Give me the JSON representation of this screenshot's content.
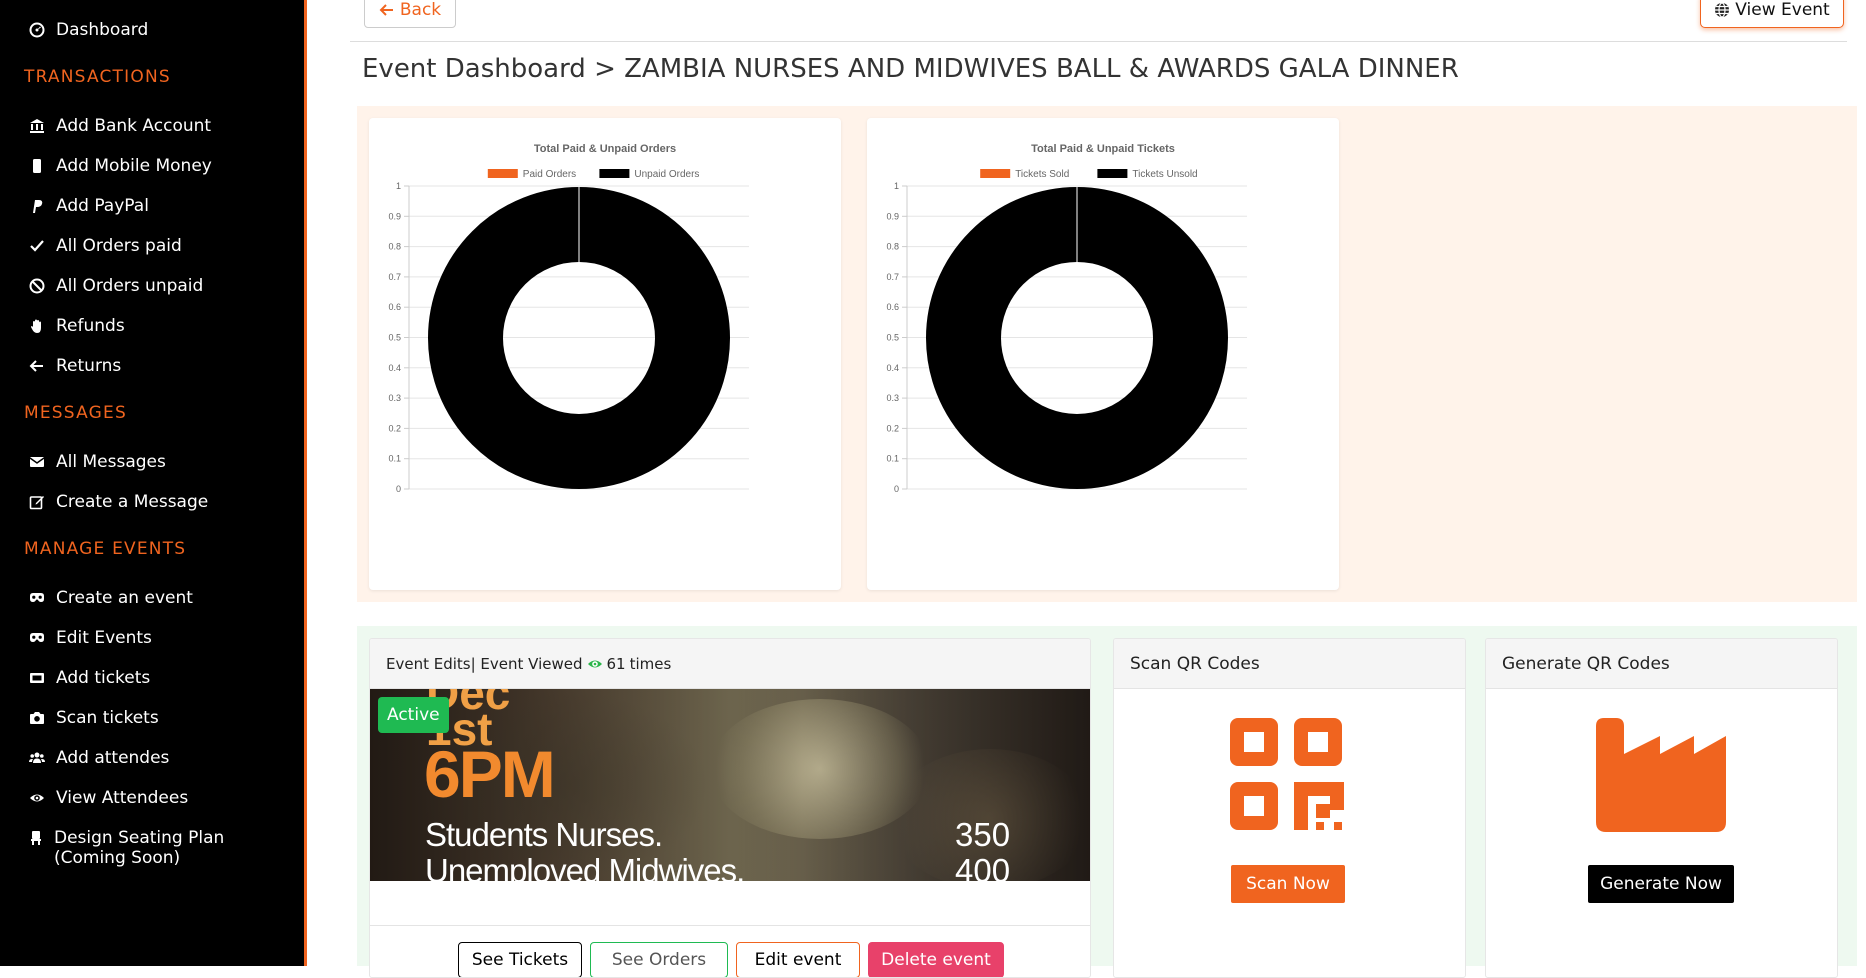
{
  "sidebar": {
    "dashboard": "Dashboard",
    "sections": {
      "transactions": "TRANSACTIONS",
      "messages": "MESSAGES",
      "manage_events": "MANAGE EVENTS"
    },
    "transactions": [
      {
        "label": "Add Bank Account",
        "icon": "bank-icon"
      },
      {
        "label": "Add Mobile Money",
        "icon": "mobile-icon"
      },
      {
        "label": "Add PayPal",
        "icon": "paypal-icon"
      },
      {
        "label": "All Orders paid",
        "icon": "check-icon"
      },
      {
        "label": "All Orders unpaid",
        "icon": "ban-icon"
      },
      {
        "label": "Refunds",
        "icon": "hand-icon"
      },
      {
        "label": "Returns",
        "icon": "arrow-left-icon"
      }
    ],
    "messages": [
      {
        "label": "All Messages",
        "icon": "envelope-icon"
      },
      {
        "label": "Create a Message",
        "icon": "edit-icon"
      }
    ],
    "manage_events": [
      {
        "label": "Create an event",
        "icon": "mask-icon"
      },
      {
        "label": "Edit Events",
        "icon": "mask-icon"
      },
      {
        "label": "Add tickets",
        "icon": "ticket-icon"
      },
      {
        "label": "Scan tickets",
        "icon": "camera-icon"
      },
      {
        "label": "Add attendes",
        "icon": "users-icon"
      },
      {
        "label": "View Attendees",
        "icon": "eye-icon"
      },
      {
        "label": "Design Seating Plan (Coming Soon)",
        "icon": "chair-icon"
      }
    ]
  },
  "header": {
    "back_label": "Back",
    "view_event_label": "View Event",
    "title": "Event Dashboard > ZAMBIA NURSES AND MIDWIVES BALL & AWARDS GALA DINNER"
  },
  "chart_data": [
    {
      "type": "pie",
      "title": "Total Paid & Unpaid Orders",
      "categories": [
        "Paid Orders",
        "Unpaid Orders"
      ],
      "values": [
        0,
        1
      ],
      "colors": [
        "#f0641f",
        "#000000"
      ],
      "ylim": [
        0,
        1
      ],
      "yticks": [
        "0",
        "0.1",
        "0.2",
        "0.3",
        "0.4",
        "0.5",
        "0.6",
        "0.7",
        "0.8",
        "0.9",
        "1"
      ],
      "grid": true,
      "legend": "top"
    },
    {
      "type": "pie",
      "title": "Total Paid & Unpaid Tickets",
      "categories": [
        "Tickets Sold",
        "Tickets Unsold"
      ],
      "values": [
        0,
        1
      ],
      "colors": [
        "#f0641f",
        "#000000"
      ],
      "ylim": [
        0,
        1
      ],
      "yticks": [
        "0",
        "0.1",
        "0.2",
        "0.3",
        "0.4",
        "0.5",
        "0.6",
        "0.7",
        "0.8",
        "0.9",
        "1"
      ],
      "grid": true,
      "legend": "top"
    }
  ],
  "event_card": {
    "header_prefix": "Event Edits| Event Viewed",
    "views": "61",
    "header_suffix": "times",
    "status": "Active",
    "image_text": {
      "date_line1": "Dec",
      "date_line2": "1st",
      "time": "6PM",
      "line1": "Students Nurses.",
      "line2": "Unemploved Midwives.",
      "price1": "350",
      "price2": "400"
    },
    "actions": {
      "see_tickets": "See Tickets",
      "see_orders": "See Orders",
      "edit_event": "Edit event",
      "delete_event": "Delete event"
    }
  },
  "scan_card": {
    "title": "Scan QR Codes",
    "button": "Scan Now",
    "icon": "qrcode-icon"
  },
  "generate_card": {
    "title": "Generate QR Codes",
    "button": "Generate Now",
    "icon": "industry-icon"
  },
  "colors": {
    "accent": "#f0641f",
    "success": "#1fba52",
    "danger": "#e8416a",
    "sidebar_bg": "#000000"
  }
}
